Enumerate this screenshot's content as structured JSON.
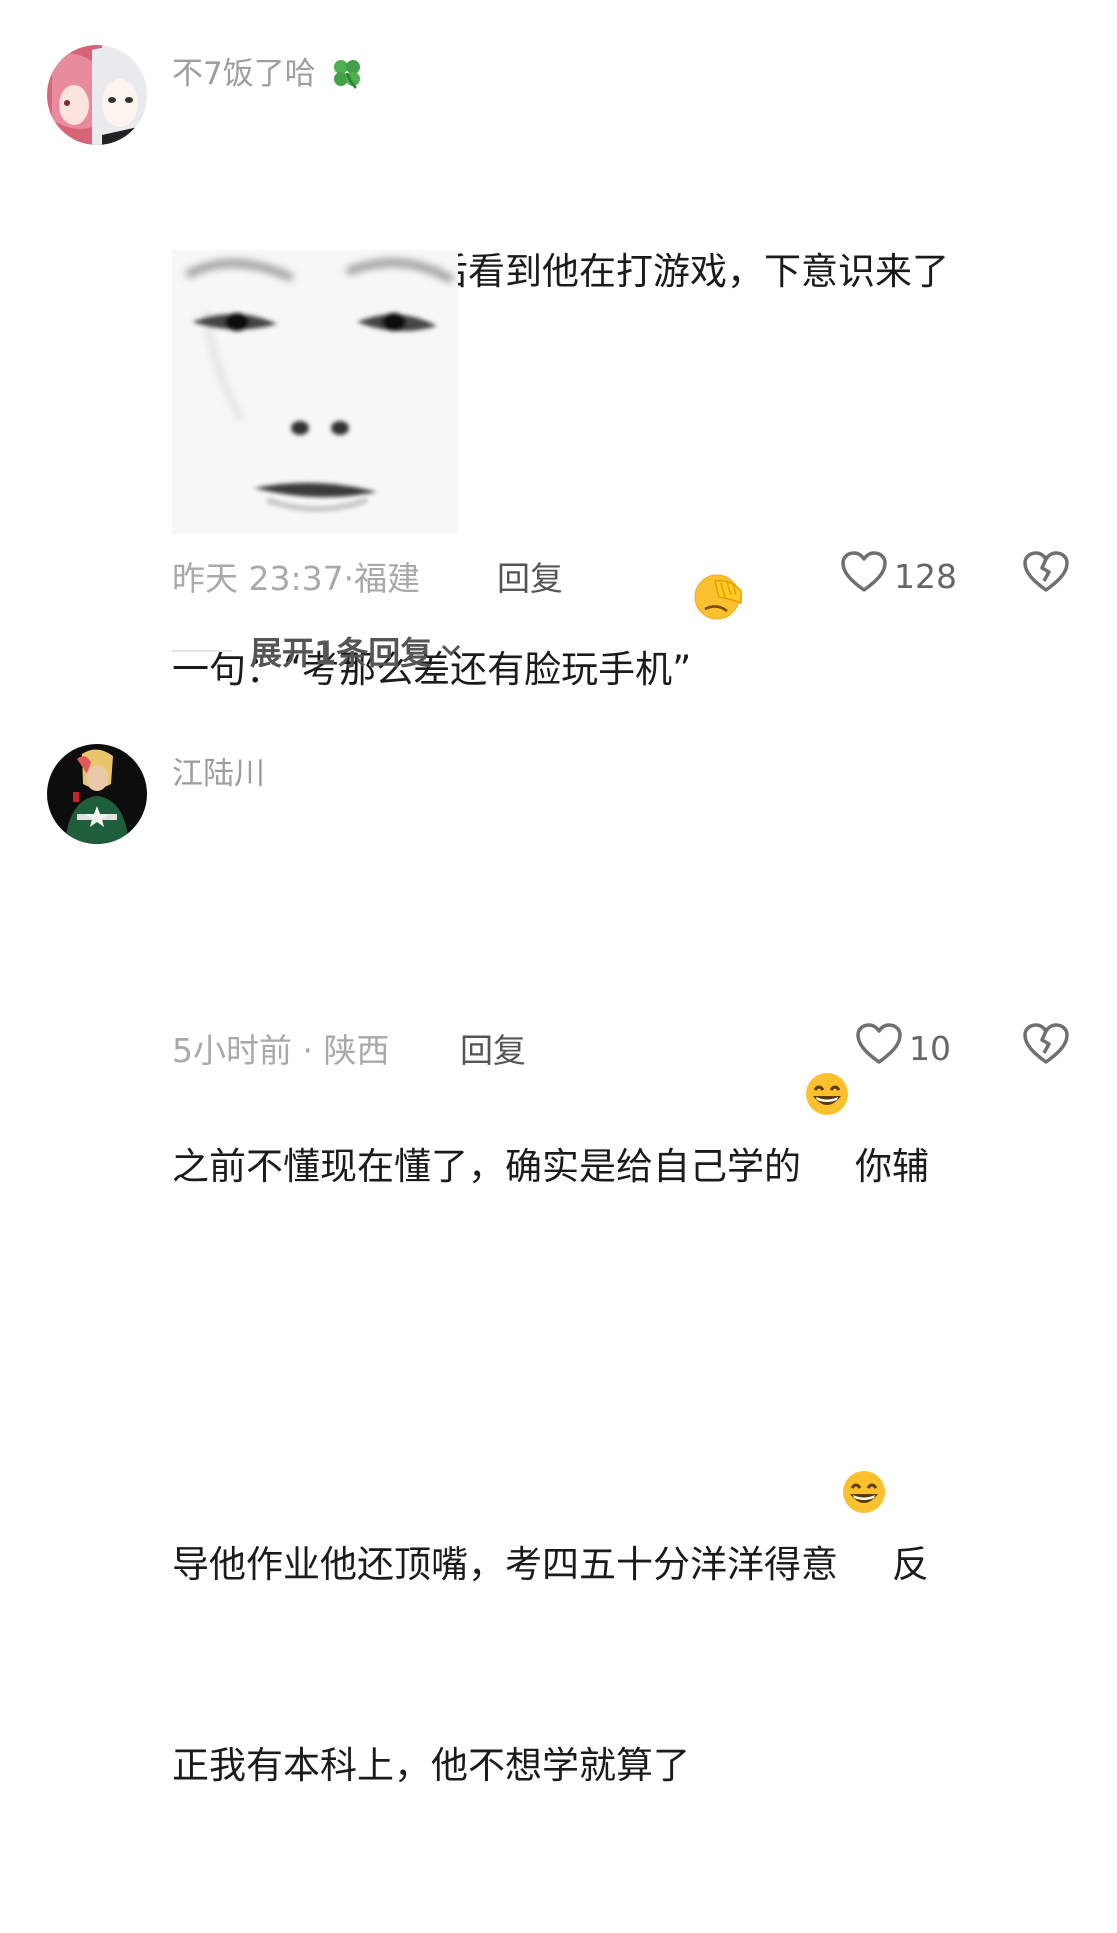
{
  "comments": [
    {
      "username": "不7饭了哈",
      "name_icon": "four-leaf-clover-icon",
      "text_line1": "我弟成绩出来以后看到他在打游戏，下意识来了",
      "text_line2": "一句：“考那么差还有脸玩手机”",
      "emoji": "face-with-hand-over-eyes",
      "sticker": "blank-stare-face-sticker",
      "time": "昨天 23:37",
      "location": "福建",
      "reply_label": "回复",
      "likes": "128",
      "expand_label": "展开1条回复"
    },
    {
      "username": "江陆川",
      "text_line1a": "之前不懂现在懂了，确实是给自己学的",
      "text_line1b": "你辅",
      "text_line2a": "导他作业他还顶嘴，考四五十分洋洋得意",
      "text_line2b": "反",
      "text_line3": "正我有本科上，他不想学就算了",
      "emoji": "grinning-face",
      "time": "5小时前",
      "location": "陕西",
      "reply_label": "回复",
      "likes": "10"
    }
  ],
  "colors": {
    "meta": "#a9a9a9",
    "username": "#9e9e9e",
    "body": "#1b1b1b"
  }
}
